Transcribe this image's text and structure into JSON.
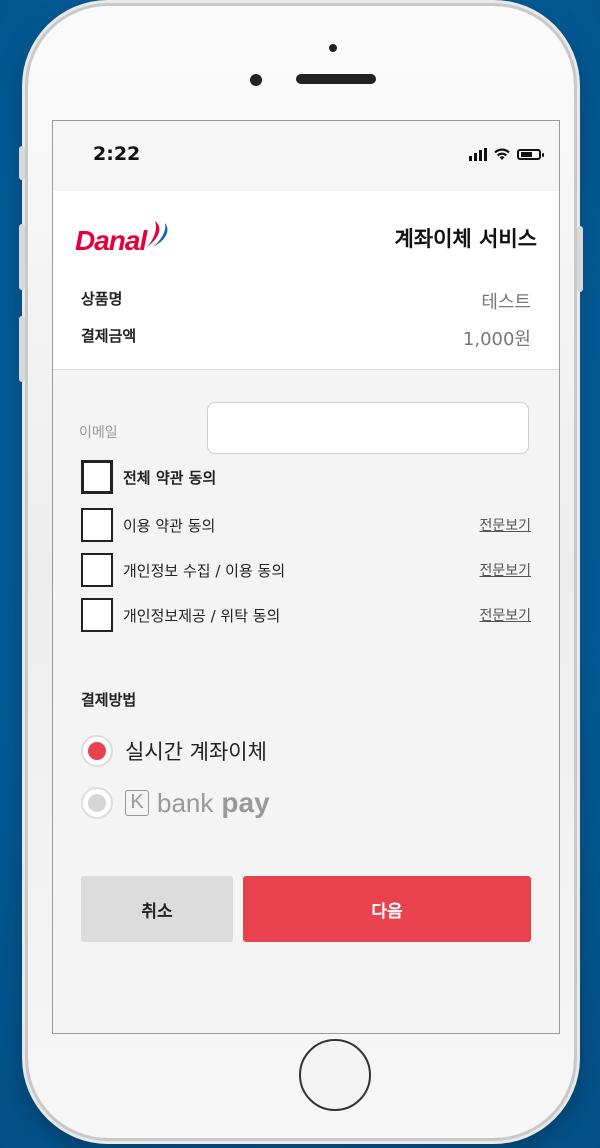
{
  "status_bar": {
    "time": "2:22"
  },
  "brand": {
    "logo_text": "Danal",
    "accent_red": "#e4003a",
    "accent_blue": "#1b5fb5"
  },
  "header": {
    "title": "계좌이체 서비스"
  },
  "order": {
    "product_label": "상품명",
    "product_value": "테스트",
    "amount_label": "결제금액",
    "amount_value": "1,000원"
  },
  "email": {
    "label": "이메일",
    "value": "",
    "placeholder": ""
  },
  "agreements": {
    "all_label": "전체 약관 동의",
    "items": [
      {
        "label": "이용 약관 동의",
        "link": "전문보기",
        "checked": false
      },
      {
        "label": "개인정보 수집 / 이용 동의",
        "link": "전문보기",
        "checked": false
      },
      {
        "label": "개인정보제공 / 위탁 동의",
        "link": "전문보기",
        "checked": false
      }
    ]
  },
  "payment_method": {
    "title": "결제방법",
    "options": [
      {
        "label": "실시간 계좌이체",
        "selected": true
      },
      {
        "k_glyph": "K",
        "bank_text": "bank",
        "pay_text": "pay",
        "selected": false,
        "disabled": true
      }
    ]
  },
  "buttons": {
    "cancel": "취소",
    "next": "다음"
  },
  "colors": {
    "primary": "#e8424f",
    "cancel_bg": "#dcdcdc",
    "background": "#04609f"
  }
}
